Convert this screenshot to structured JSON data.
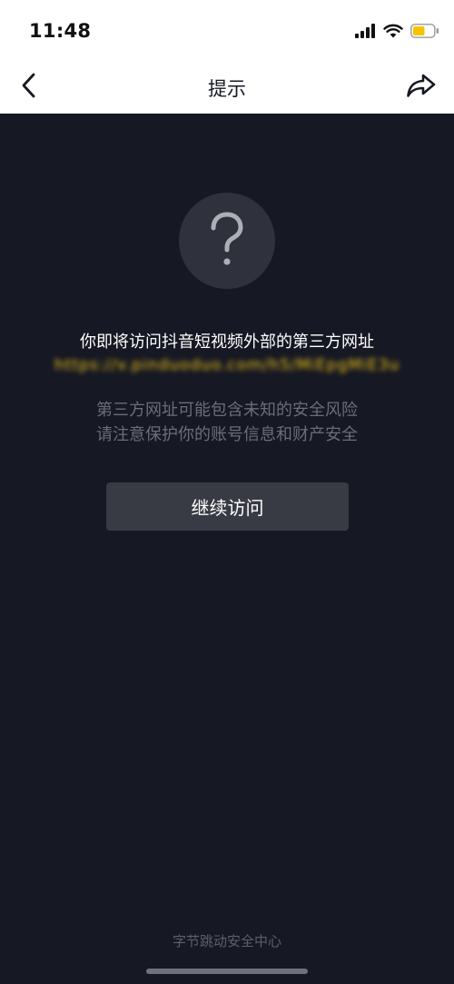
{
  "status_bar": {
    "time": "11:48",
    "signal_icon": "cellular-signal-icon",
    "wifi_icon": "wifi-icon",
    "battery_icon": "battery-icon",
    "battery_color": "#f5c400"
  },
  "nav": {
    "title": "提示",
    "back_icon": "chevron-left-icon",
    "share_icon": "share-arrow-icon"
  },
  "main": {
    "icon": "question-mark-icon",
    "heading": "你即将访问抖音短视频外部的第三方网址",
    "url": "https://v.pinduoduo.com/h5/MiEpgMiE3uu6",
    "warning_line1": "第三方网址可能包含未知的安全风险",
    "warning_line2": "请注意保护你的账号信息和财产安全",
    "continue_label": "继续访问"
  },
  "footer": {
    "text": "字节跳动安全中心"
  },
  "colors": {
    "background": "#161823",
    "accent_url": "#f0c419",
    "button_bg": "#393b44"
  }
}
